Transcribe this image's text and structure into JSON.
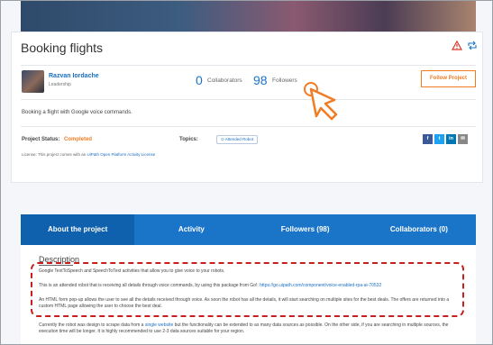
{
  "project": {
    "title": "Booking flights",
    "author_name": "Razvan Iordache",
    "author_role": "Leadership",
    "short_description": "Booking a flight with Google voice commands.",
    "follow_label": "Follow Project"
  },
  "stats": {
    "collaborators_count": "0",
    "collaborators_label": "Collaborators",
    "followers_count": "98",
    "followers_label": "Followers"
  },
  "meta": {
    "status_label": "Project Status:",
    "status_value": "Completed",
    "topics_label": "Topics:",
    "topic_tag": "Attended Robot",
    "license_prefix": "License: This project comes with an",
    "license_link": "UiPath Open Platform Activity License"
  },
  "share_buttons": [
    {
      "icon": "facebook-icon",
      "glyph": "f",
      "color": "#3b5998"
    },
    {
      "icon": "twitter-icon",
      "glyph": "t",
      "color": "#1da1f2"
    },
    {
      "icon": "linkedin-icon",
      "glyph": "in",
      "color": "#0077b5"
    },
    {
      "icon": "email-icon",
      "glyph": "✉",
      "color": "#888888"
    }
  ],
  "tabs": [
    {
      "label": "About the project"
    },
    {
      "label": "Activity"
    },
    {
      "label": "Followers (98)"
    },
    {
      "label": "Collaborators (0)"
    }
  ],
  "content": {
    "heading": "Description",
    "p1": "Google TextToSpeech and SpeechToText activities that allow you to give voice to your robots.",
    "p2_text": "This is an attended robot that is receiving all details through voice commands, by using this package from Go!:",
    "p2_link": "https://go.uipath.com/component/voice-enabled-rpa-ai-70532",
    "p3": "An HTML form pop-up allows the user to see all the details received through voice. As soon the robot has all the details, it will start searching on multiple sites for the best deals. The offers are returned into a custom HTML page allowing the user to choose the best deal.",
    "p4_a": "Currently the robot was design to scrape data from a",
    "p4_link": "single website",
    "p4_b": "but the functionality can be extended to as many data sources as possible. On the other side, if you are searching in multiple sources, the execution time will be longer. It is highly recommended to use 2-3 data sources suitable for your region."
  },
  "colors": {
    "accent": "#1a74c8",
    "orange": "#f17c24",
    "highlight": "#c81e1e"
  }
}
